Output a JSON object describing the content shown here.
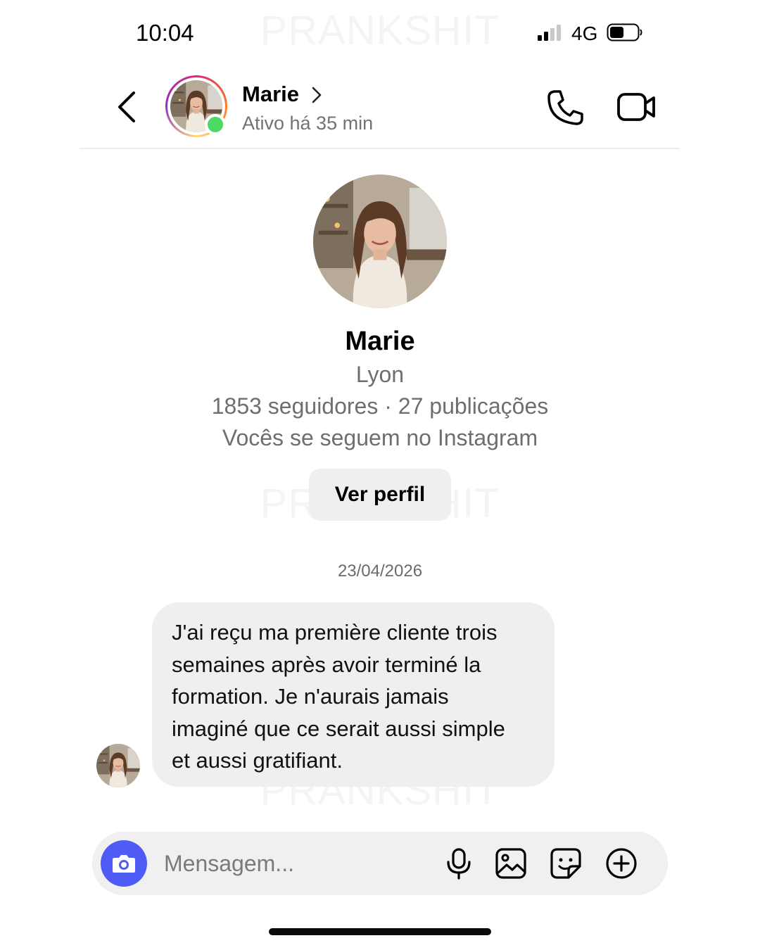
{
  "status_bar": {
    "time": "10:04",
    "network": "4G"
  },
  "watermark": "PRANKSHIT",
  "header": {
    "name": "Marie",
    "status": "Ativo há 35 min"
  },
  "profile": {
    "name": "Marie",
    "city": "Lyon",
    "stats": "1853 seguidores · 27 publicações",
    "mutual": "Vocês se seguem no Instagram",
    "view_profile_label": "Ver perfil"
  },
  "conversation": {
    "date": "23/04/2026",
    "messages": [
      {
        "lines": [
          "J'ai reçu ma première cliente trois",
          "semaines après avoir terminé la",
          "formation. Je n'aurais jamais",
          "imaginé que ce serait aussi simple",
          "et aussi gratifiant."
        ]
      }
    ]
  },
  "composer": {
    "placeholder": "Mensagem..."
  },
  "colors": {
    "accent": "#4e5bf5",
    "online": "#4cd964",
    "bubble": "#efefef",
    "secondary_text": "#6e6e6e"
  },
  "icons": [
    "back-chevron-icon",
    "chevron-right-icon",
    "phone-icon",
    "video-camera-icon",
    "camera-icon",
    "microphone-icon",
    "gallery-icon",
    "sticker-icon",
    "plus-circle-icon"
  ]
}
